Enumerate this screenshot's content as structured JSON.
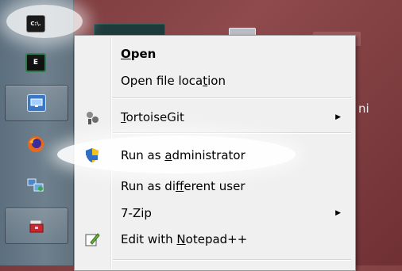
{
  "desktop": {
    "partial_text": "ni"
  },
  "taskbar": {
    "items": [
      {
        "name": "cmd",
        "glyph": "C:\\."
      },
      {
        "name": "terminal",
        "glyph": "E"
      },
      {
        "name": "remote-desktop",
        "glyph": ""
      },
      {
        "name": "firefox",
        "glyph": ""
      },
      {
        "name": "network",
        "glyph": ""
      },
      {
        "name": "toolbox",
        "glyph": ""
      }
    ]
  },
  "menu": {
    "items": {
      "open": {
        "before": "",
        "key": "O",
        "after": "pen"
      },
      "open_location": {
        "before": "Open file loca",
        "key": "t",
        "after": "ion"
      },
      "tortoisegit": {
        "before": "",
        "key": "T",
        "after": "ortoiseGit"
      },
      "run_admin": {
        "before": "Run as ",
        "key": "a",
        "after": "dministrator"
      },
      "run_different": {
        "before": "Run as di",
        "key": "f",
        "after": "ferent user"
      },
      "seven_zip": {
        "before": "7-Zip",
        "key": "",
        "after": ""
      },
      "notepadpp": {
        "before": "Edit with ",
        "key": "N",
        "after": "otepad++"
      }
    }
  },
  "colors": {
    "menu_bg": "#f0f0f0",
    "highlight": "#ffffff"
  }
}
